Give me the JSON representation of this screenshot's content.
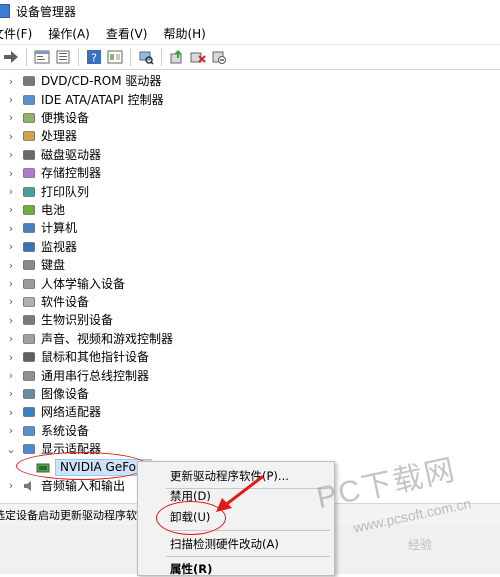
{
  "window": {
    "title": "设备管理器"
  },
  "menubar": {
    "items": [
      "文件(F)",
      "操作(A)",
      "查看(V)",
      "帮助(H)"
    ]
  },
  "toolbar": {
    "icons": [
      "back-arrow-icon",
      "forward-arrow-icon",
      "properties-icon",
      "refresh-icon",
      "help-icon",
      "show-hidden-icon",
      "update-driver-icon",
      "scan-hardware-icon",
      "uninstall-icon",
      "disable-icon"
    ]
  },
  "tree": {
    "categories": [
      "DVD/CD-ROM 驱动器",
      "IDE ATA/ATAPI 控制器",
      "便携设备",
      "处理器",
      "磁盘驱动器",
      "存储控制器",
      "打印队列",
      "电池",
      "计算机",
      "监视器",
      "键盘",
      "人体学输入设备",
      "软件设备",
      "生物识别设备",
      "声音、视频和游戏控制器",
      "鼠标和其他指针设备",
      "通用串行总线控制器",
      "图像设备",
      "网络适配器",
      "系统设备",
      "显示适配器"
    ],
    "expanded_child": "NVIDIA GeForc",
    "after_child": "音频输入和输出"
  },
  "statusbar": {
    "text": "选定设备启动更新驱动程序软"
  },
  "context_menu": {
    "items": [
      "更新驱动程序软件(P)...",
      "禁用(D)",
      "卸载(U)",
      "扫描检测硬件改动(A)",
      "属性(R)"
    ]
  },
  "watermark": {
    "main": "PC下载网",
    "url": "www.pcsoft.com.cn",
    "tag": "经验"
  },
  "colors": {
    "selection": "#cfe3f7",
    "annotation": "#e01919",
    "accent": "#3c7bd1"
  }
}
